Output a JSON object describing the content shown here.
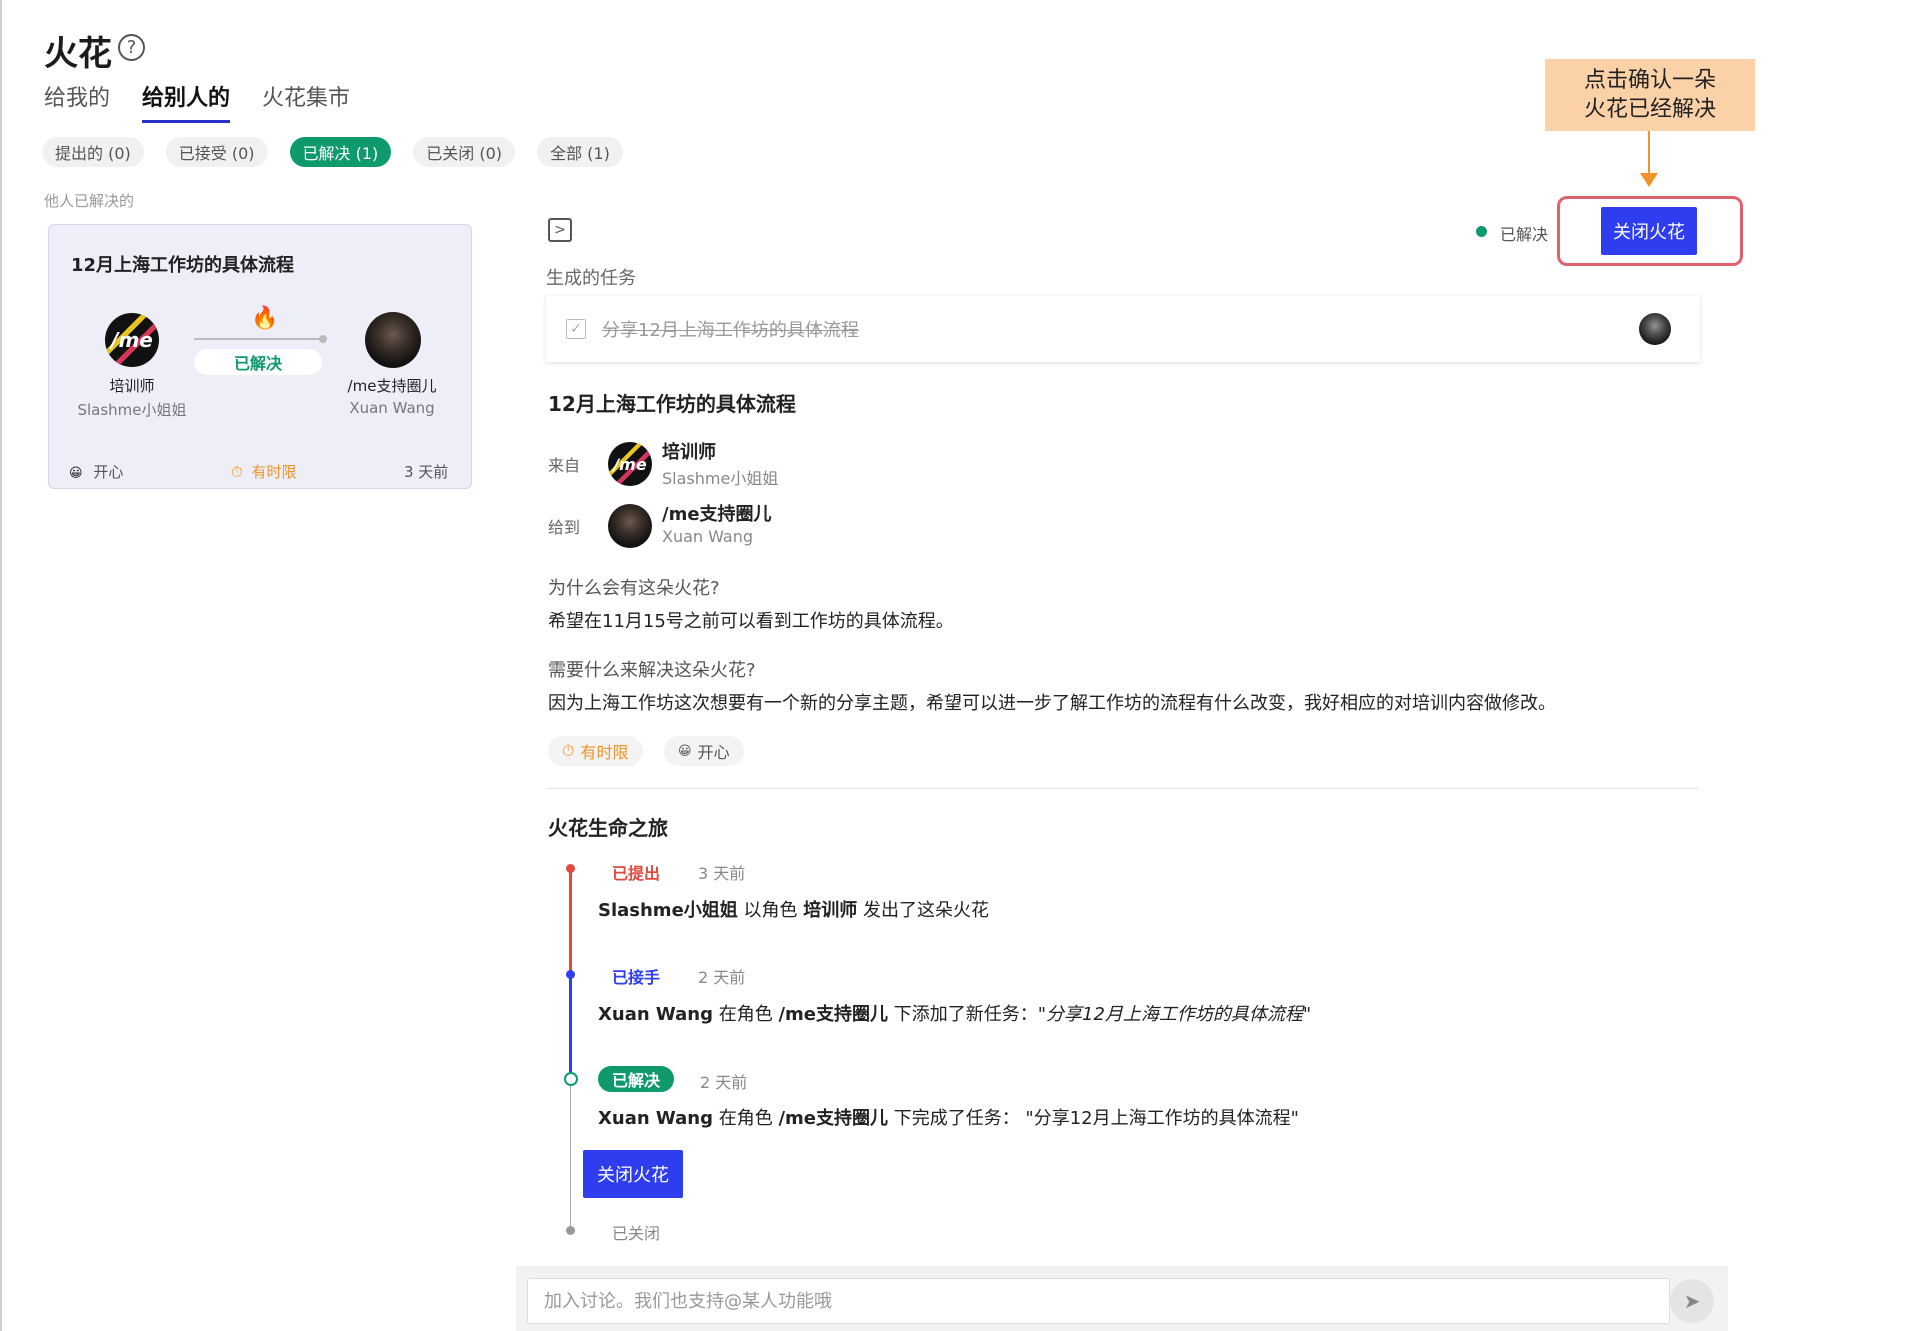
{
  "header": {
    "title": "火花",
    "help_icon": "?"
  },
  "tabs": [
    {
      "label": "给我的",
      "active": false
    },
    {
      "label": "给别人的",
      "active": true
    },
    {
      "label": "火花集市",
      "active": false
    }
  ],
  "filters": [
    {
      "label": "提出的 (0)",
      "active": false
    },
    {
      "label": "已接受 (0)",
      "active": false
    },
    {
      "label": "已解决 (1)",
      "active": true
    },
    {
      "label": "已关闭 (0)",
      "active": false
    },
    {
      "label": "全部 (1)",
      "active": false
    }
  ],
  "list_section_label": "他人已解决的",
  "card": {
    "title": "12月上海工作坊的具体流程",
    "status": "已解决",
    "from": {
      "avatar_text": "/me",
      "name": "培训师",
      "sub": "Slashme小姐姐"
    },
    "to": {
      "name": "/me支持圈儿",
      "sub": "Xuan Wang"
    },
    "mood": "开心",
    "mood_icon": "😀",
    "deadline": "有时限",
    "deadline_icon": "⏱",
    "age": "3 天前"
  },
  "detail": {
    "status_label": "已解决",
    "close_button": "关闭火花",
    "generated_tasks_label": "生成的任务",
    "task": {
      "text": "分享12月上海工作坊的具体流程",
      "done": true
    },
    "title": "12月上海工作坊的具体流程",
    "from_label": "来自",
    "from": {
      "name": "培训师",
      "sub": "Slashme小姐姐"
    },
    "to_label": "给到",
    "to": {
      "name": "/me支持圈儿",
      "sub": "Xuan Wang"
    },
    "why_q": "为什么会有这朵火花?",
    "why_a": "希望在11月15号之前可以看到工作坊的具体流程。",
    "need_q": "需要什么来解决这朵火花?",
    "need_a": "因为上海工作坊这次想要有一个新的分享主题，希望可以进一步了解工作坊的流程有什么改变，我好相应的对培训内容做修改。",
    "tags": [
      {
        "icon": "⏱",
        "label": "有时限",
        "color": "#f0932a"
      },
      {
        "icon": "😀",
        "label": "开心",
        "color": "#555555"
      }
    ]
  },
  "timeline": {
    "title": "火花生命之旅",
    "events": [
      {
        "status": "已提出",
        "status_color": "#e0493c",
        "time": "3 天前",
        "parts": [
          {
            "t": "Slashme小姐姐",
            "b": true
          },
          {
            "t": " 以角色 ",
            "b": false
          },
          {
            "t": "培训师",
            "b": true
          },
          {
            "t": " 发出了这朵火花",
            "b": false
          }
        ]
      },
      {
        "status": "已接手",
        "status_color": "#2e3df0",
        "time": "2 天前",
        "parts": [
          {
            "t": "Xuan Wang",
            "b": true
          },
          {
            "t": " 在角色 ",
            "b": false
          },
          {
            "t": "/me支持圈儿",
            "b": true
          },
          {
            "t": " 下添加了新任务：\"",
            "b": false
          },
          {
            "t": "分享12月上海工作坊的具体流程",
            "b": false,
            "i": true
          },
          {
            "t": "\"",
            "b": false
          }
        ]
      },
      {
        "status": "已解决",
        "status_color": "#0e9a6d",
        "time": "2 天前",
        "parts": [
          {
            "t": "Xuan Wang",
            "b": true
          },
          {
            "t": " 在角色 ",
            "b": false
          },
          {
            "t": "/me支持圈儿",
            "b": true
          },
          {
            "t": " 下完成了任务：  \"分享12月上海工作坊的具体流程\"",
            "b": false
          }
        ]
      }
    ],
    "close_button": "关闭火花",
    "closed_label": "已关闭"
  },
  "annotation": {
    "callout_line1": "点击确认一朵",
    "callout_line2": "火花已经解决",
    "color": "#fbd1a8"
  },
  "discussion": {
    "placeholder": "加入讨论。我们也支持@某人功能哦",
    "send_icon": "send-icon"
  },
  "colors": {
    "accent_blue": "#2e3df0",
    "resolved_green": "#0e9a6d",
    "proposed_red": "#e0493c",
    "highlight_red": "#e0606e",
    "arrow_orange": "#f0932a"
  }
}
